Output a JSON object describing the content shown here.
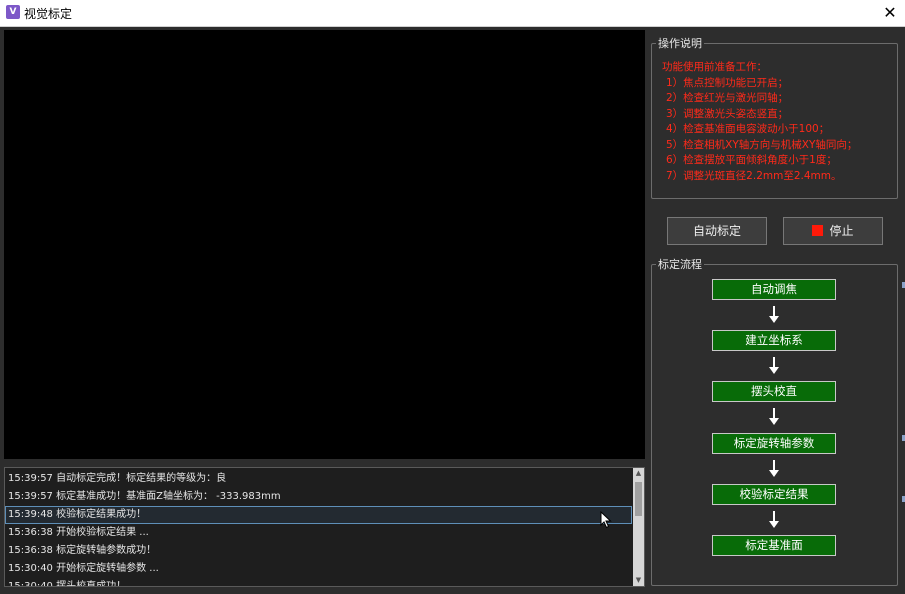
{
  "window": {
    "title": "视觉标定",
    "close_glyph": "✕"
  },
  "log": {
    "rows": [
      {
        "text": "15:39:57 自动标定完成！标定结果的等级为：良"
      },
      {
        "text": "15:39:57 标定基准成功！基准面Z轴坐标为： -333.983mm"
      },
      {
        "text": "15:39:48 校验标定结果成功！"
      },
      {
        "text": "15:36:38 开始校验标定结果 ..."
      },
      {
        "text": "15:36:38 标定旋转轴参数成功！"
      },
      {
        "text": "15:30:40 开始标定旋转轴参数 ..."
      },
      {
        "text": "15:30:40 摆头校直成功！"
      }
    ],
    "selected_index": 2
  },
  "instructions": {
    "title": "操作说明",
    "heading": "功能使用前准备工作：",
    "items": [
      "1）焦点控制功能已开启；",
      "2）检查红光与激光同轴；",
      "3）调整激光头姿态竖直；",
      "4）检查基准面电容波动小于100；",
      "5）检查相机XY轴方向与机械XY轴同向；",
      "6）检查摆放平面倾斜角度小于1度；",
      "7）调整光斑直径2.2mm至2.4mm。"
    ]
  },
  "buttons": {
    "auto": "自动标定",
    "stop": "停止"
  },
  "flow": {
    "title": "标定流程",
    "steps": [
      "自动调焦",
      "建立坐标系",
      "摆头校直",
      "标定旋转轴参数",
      "校验标定结果",
      "标定基准面"
    ]
  },
  "colors": {
    "instruction_text": "#ff2a1a",
    "step_fill": "#086b08",
    "stop_icon": "#ff1a0a"
  }
}
